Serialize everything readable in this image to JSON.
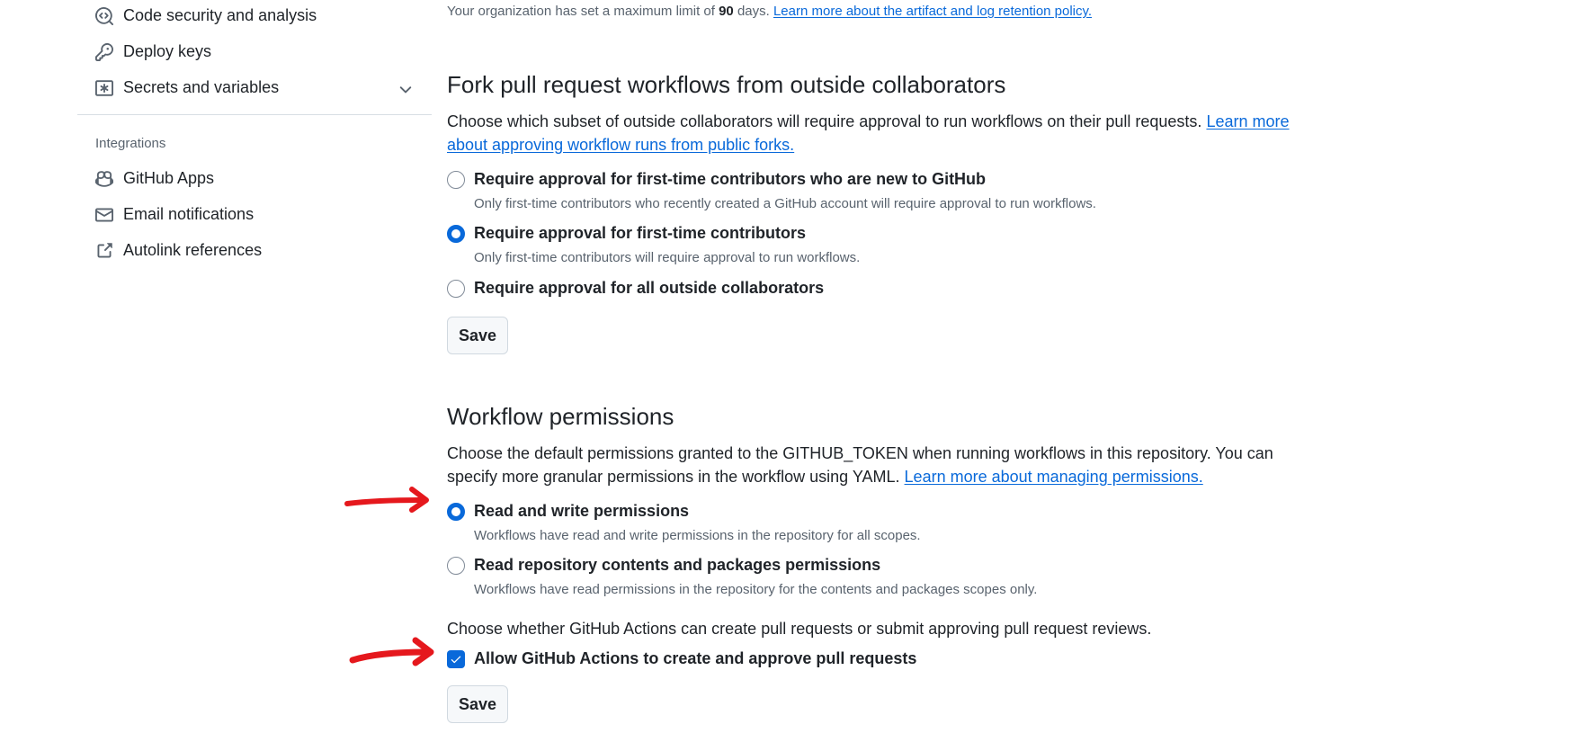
{
  "sidebar": {
    "items": [
      {
        "label": "Code security and analysis",
        "icon": "codescan-icon"
      },
      {
        "label": "Deploy keys",
        "icon": "key-icon"
      },
      {
        "label": "Secrets and variables",
        "icon": "asterisk-icon"
      }
    ],
    "integrations_heading": "Integrations",
    "integrations": [
      {
        "label": "GitHub Apps",
        "icon": "copilot-icon"
      },
      {
        "label": "Email notifications",
        "icon": "mail-icon"
      },
      {
        "label": "Autolink references",
        "icon": "link-external-icon"
      }
    ]
  },
  "retention": {
    "prefix": "Your organization has set a maximum limit of ",
    "days": "90",
    "suffix": " days. ",
    "link": "Learn more about the artifact and log retention policy."
  },
  "fork": {
    "title": "Fork pull request workflows from outside collaborators",
    "description": "Choose which subset of outside collaborators will require approval to run workflows on their pull requests. ",
    "link": "Learn more about approving workflow runs from public forks.",
    "options": [
      {
        "label": "Require approval for first-time contributors who are new to GitHub",
        "desc": "Only first-time contributors who recently created a GitHub account will require approval to run workflows.",
        "checked": false
      },
      {
        "label": "Require approval for first-time contributors",
        "desc": "Only first-time contributors will require approval to run workflows.",
        "checked": true
      },
      {
        "label": "Require approval for all outside collaborators",
        "desc": "",
        "checked": false
      }
    ],
    "save_label": "Save"
  },
  "workflow": {
    "title": "Workflow permissions",
    "description": "Choose the default permissions granted to the GITHUB_TOKEN when running workflows in this repository. You can specify more granular permissions in the workflow using YAML. ",
    "link": "Learn more about managing permissions.",
    "options": [
      {
        "label": "Read and write permissions",
        "desc": "Workflows have read and write permissions in the repository for all scopes.",
        "checked": true
      },
      {
        "label": "Read repository contents and packages permissions",
        "desc": "Workflows have read permissions in the repository for the contents and packages scopes only.",
        "checked": false
      }
    ],
    "pr_description": "Choose whether GitHub Actions can create pull requests or submit approving pull request reviews.",
    "checkbox_label": "Allow GitHub Actions to create and approve pull requests",
    "checkbox_checked": true,
    "save_label": "Save"
  },
  "colors": {
    "accent": "#0969da",
    "annotation": "#e5181d"
  }
}
